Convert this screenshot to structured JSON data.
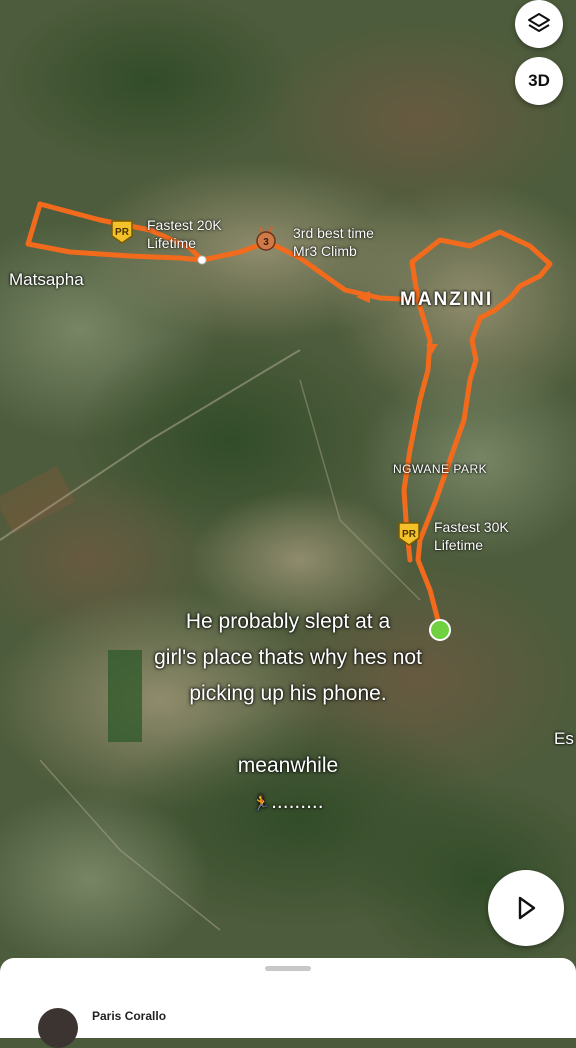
{
  "map": {
    "places": {
      "matsapha": "Matsapha",
      "manzini": "MANZINI",
      "ngwane_park": "NGWANE PARK",
      "edge": "Es"
    },
    "achievements": [
      {
        "icon": "pr-badge-icon",
        "badge_text": "PR",
        "line1": "Fastest 20K",
        "line2": "Lifetime"
      },
      {
        "icon": "medal-icon",
        "badge_text": "3",
        "line1": "3rd best time",
        "line2": "Mr3 Climb"
      },
      {
        "icon": "pr-badge-icon",
        "badge_text": "PR",
        "line1": "Fastest 30K",
        "line2": "Lifetime"
      }
    ],
    "route_color": "#f26b1d",
    "start_marker_color": "#6fd13f"
  },
  "controls": {
    "layers_icon": "layers-icon",
    "three_d_label": "3D",
    "play_icon": "play-icon"
  },
  "caption": {
    "line1": "He probably slept at a",
    "line2": "girl's place thats why hes not",
    "line3": "picking up his phone.",
    "line4": "meanwhile",
    "line5_emoji": "🏃",
    "line5_text": "........."
  },
  "sheet": {
    "athlete_name": "Paris Corallo"
  }
}
